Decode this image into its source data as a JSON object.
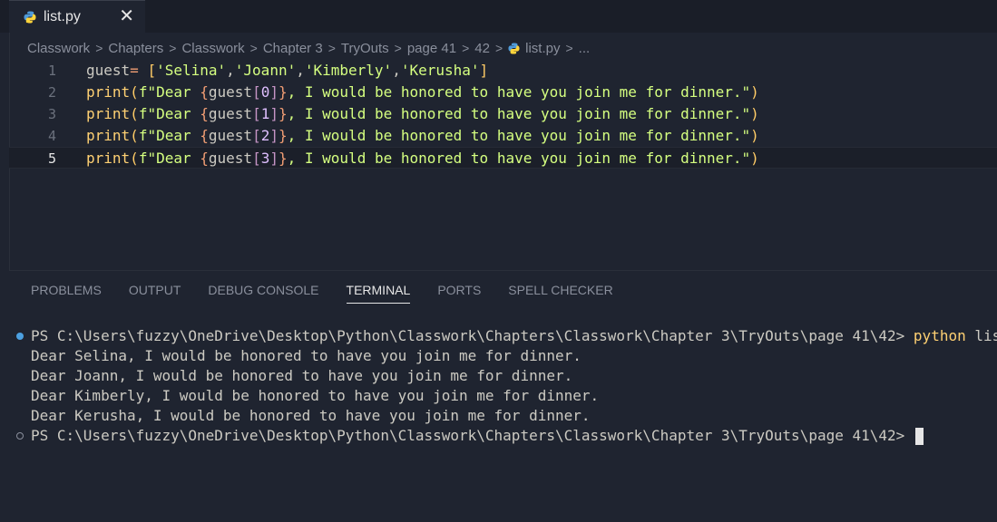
{
  "tab": {
    "label": "list.py",
    "close_glyph": "✕",
    "icon": "python-icon"
  },
  "breadcrumb": {
    "items": [
      "Classwork",
      "Chapters",
      "Classwork",
      "Chapter 3",
      "TryOuts",
      "page 41",
      "42"
    ],
    "file": "list.py",
    "trailing": "...",
    "separator": ">"
  },
  "editor": {
    "active_line": 5,
    "lines": [
      {
        "num": "1",
        "t": [
          "guest",
          "= ",
          "[",
          "'Selina'",
          ",",
          "'Joann'",
          ",",
          "'Kimberly'",
          ",",
          "'Kerusha'",
          "]"
        ]
      },
      {
        "num": "2",
        "t": [
          "print",
          "(",
          "f\"Dear ",
          "{",
          "guest",
          "[",
          "0",
          "]",
          "}",
          ", I would be honored to have you join me for dinner.\"",
          ")"
        ]
      },
      {
        "num": "3",
        "t": [
          "print",
          "(",
          "f\"Dear ",
          "{",
          "guest",
          "[",
          "1",
          "]",
          "}",
          ", I would be honored to have you join me for dinner.\"",
          ")"
        ]
      },
      {
        "num": "4",
        "t": [
          "print",
          "(",
          "f\"Dear ",
          "{",
          "guest",
          "[",
          "2",
          "]",
          "}",
          ", I would be honored to have you join me for dinner.\"",
          ")"
        ]
      },
      {
        "num": "5",
        "t": [
          "print",
          "(",
          "f\"Dear ",
          "{",
          "guest",
          "[",
          "3",
          "]",
          "}",
          ", I would be honored to have you join me for dinner.\"",
          ")"
        ]
      }
    ]
  },
  "panel": {
    "tabs": [
      "PROBLEMS",
      "OUTPUT",
      "DEBUG CONSOLE",
      "TERMINAL",
      "PORTS",
      "SPELL CHECKER"
    ],
    "active_tab": "TERMINAL"
  },
  "terminal": {
    "prompt": "PS C:\\Users\\fuzzy\\OneDrive\\Desktop\\Python\\Classwork\\Chapters\\Classwork\\Chapter 3\\TryOuts\\page 41\\42> ",
    "command_keyword": "python",
    "command_arg": " list.py",
    "output": [
      "Dear Selina, I would be honored to have you join me for dinner.",
      "Dear Joann, I would be honored to have you join me for dinner.",
      "Dear Kimberly, I would be honored to have you join me for dinner.",
      "Dear Kerusha, I would be honored to have you join me for dinner."
    ],
    "final_prompt": "PS C:\\Users\\fuzzy\\OneDrive\\Desktop\\Python\\Classwork\\Chapters\\Classwork\\Chapter 3\\TryOuts\\page 41\\42> "
  },
  "colors": {
    "background": "#1f2430",
    "string": "#d5ff80",
    "function": "#ffd173",
    "number": "#dfbfff",
    "terminal_dot": "#4ca0e0"
  }
}
